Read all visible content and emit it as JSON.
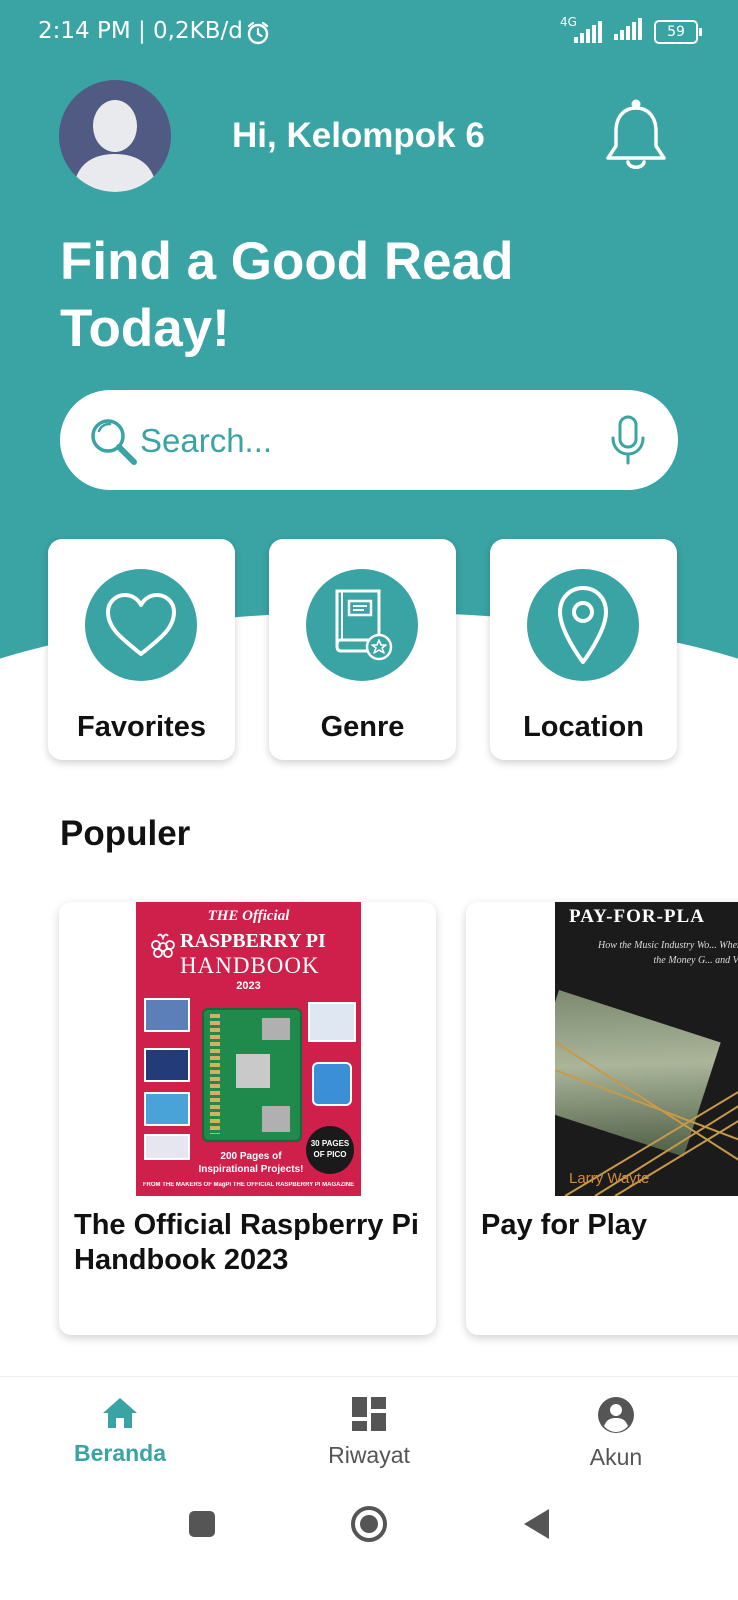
{
  "status_bar": {
    "time_text": "2:14 PM | 0,2KB/d",
    "network": "4G",
    "battery": "59",
    "icons": [
      "alarm-icon",
      "signal-icon",
      "signal-icon",
      "battery-icon"
    ]
  },
  "header": {
    "greeting": "Hi, Kelompok 6",
    "headline": "Find a Good Read Today!",
    "icons": [
      "avatar-icon",
      "bell-icon"
    ]
  },
  "search": {
    "placeholder": "Search...",
    "icons": [
      "search-icon",
      "mic-icon"
    ]
  },
  "quick_actions": [
    {
      "label": "Favorites",
      "icon": "heart-icon"
    },
    {
      "label": "Genre",
      "icon": "book-icon"
    },
    {
      "label": "Location",
      "icon": "location-pin-icon"
    }
  ],
  "popular": {
    "title": "Populer",
    "books": [
      {
        "title": "The Official Raspberry Pi Handbook 2023",
        "cover_text": {
          "tag": "THE Official",
          "brand": "RASPBERRY PI",
          "subtitle": "HANDBOOK",
          "year": "2023",
          "promo": "200 Pages of Inspirational Projects!",
          "badge": "30 PAGES OF PICO",
          "footer": "FROM THE MAKERS OF MagPi THE OFFICIAL RASPBERRY PI MAGAZINE"
        }
      },
      {
        "title": "Pay for Play",
        "cover_text": {
          "heading": "PAY-FOR-PLA",
          "subtitle": "How the Music Industry Wo... Where the Money G... and V...",
          "author": "Larry Wayte"
        }
      }
    ]
  },
  "bottom_nav": [
    {
      "label": "Beranda",
      "icon": "home-icon",
      "active": true
    },
    {
      "label": "Riwayat",
      "icon": "dashboard-icon",
      "active": false
    },
    {
      "label": "Akun",
      "icon": "account-icon",
      "active": false
    }
  ],
  "colors": {
    "primary": "#3aa3a4",
    "background": "#ffffff",
    "text": "#111111",
    "cover_red": "#cf1f4b"
  }
}
